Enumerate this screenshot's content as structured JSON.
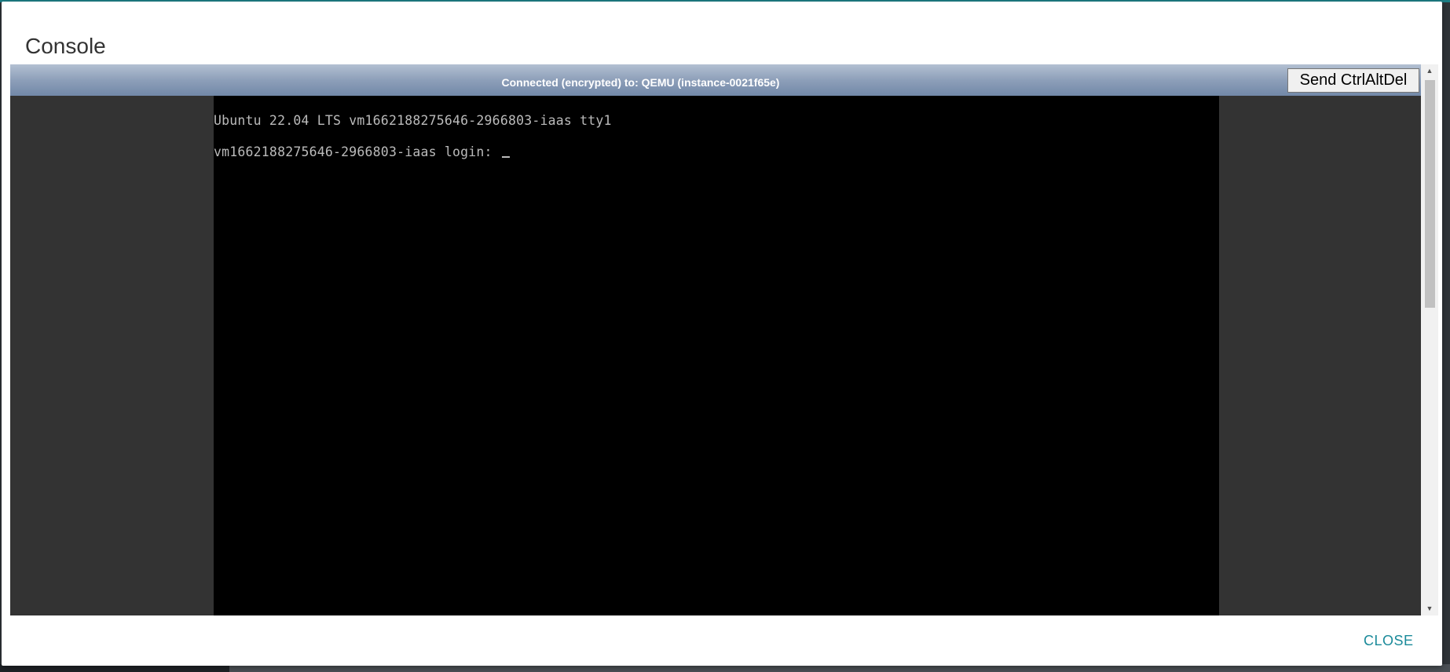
{
  "dialog": {
    "title": "Console",
    "close_label": "CLOSE"
  },
  "console": {
    "status_text": "Connected (encrypted) to: QEMU (instance-0021f65e)",
    "send_cad_label": "Send CtrlAltDel",
    "terminal": {
      "line1": "Ubuntu 22.04 LTS vm1662188275646-2966803-iaas tty1",
      "line2": "vm1662188275646-2966803-iaas login: "
    }
  },
  "colors": {
    "accent": "#1a8a9a",
    "status_bar": "#8d9fb9",
    "terminal_bg": "#000000",
    "terminal_fg": "#bbbbbb"
  },
  "icons": {
    "scroll_up": "triangle-up-icon",
    "scroll_down": "triangle-down-icon"
  }
}
